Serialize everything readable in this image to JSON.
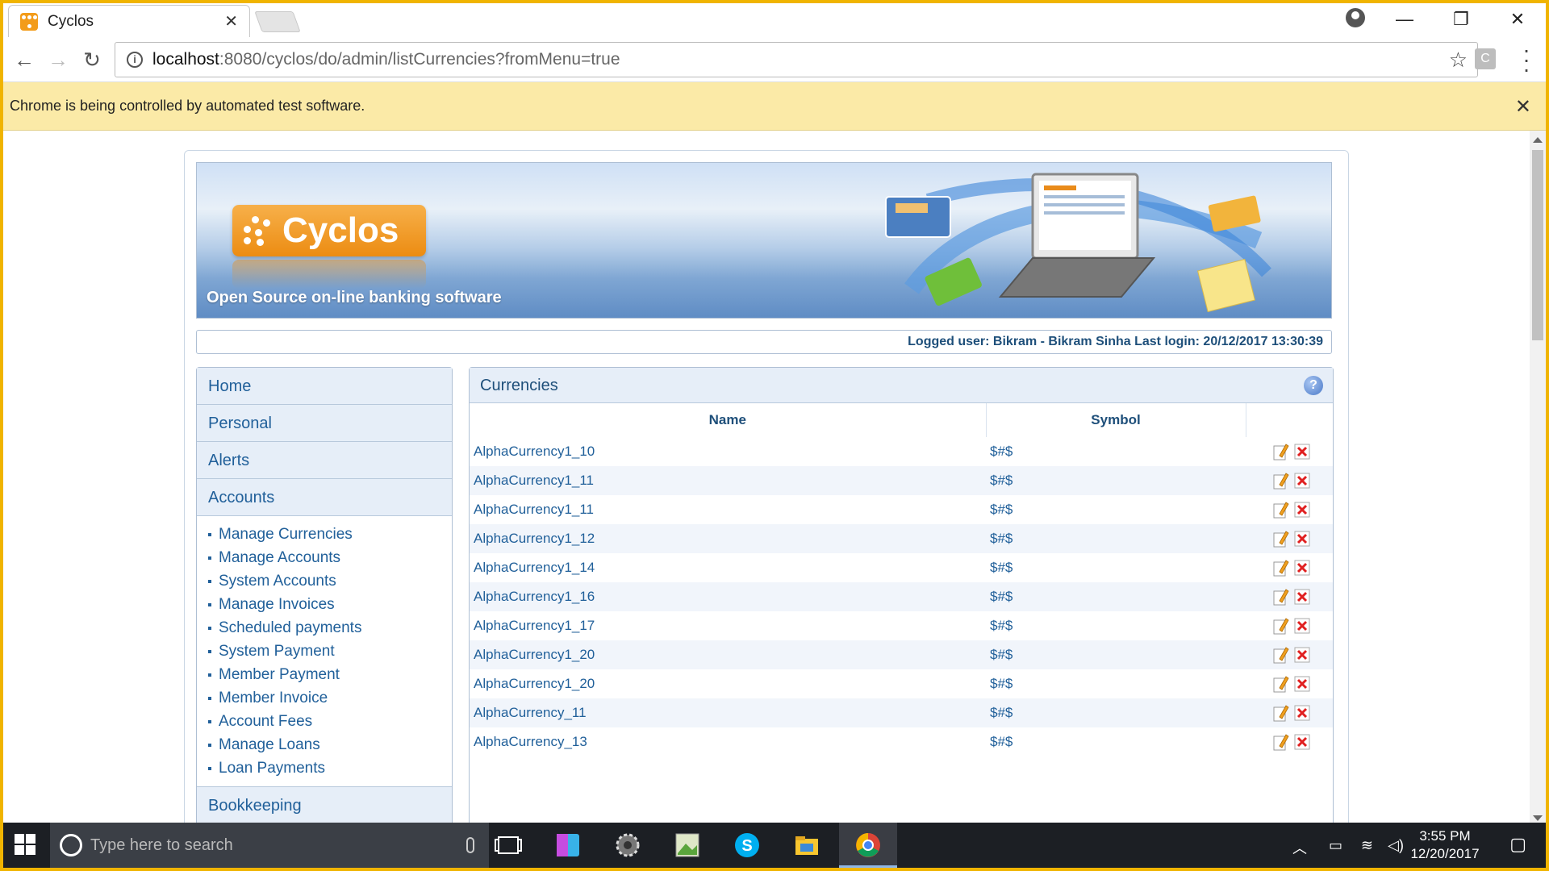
{
  "browser": {
    "tab_title": "Cyclos",
    "url_host": "localhost",
    "url_path": ":8080/cyclos/do/admin/listCurrencies?fromMenu=true",
    "infobar_message": "Chrome is being controlled by automated test software.",
    "extension_label": "C"
  },
  "banner": {
    "logo_text": "Cyclos",
    "tagline": "Open Source on-line banking software"
  },
  "userbar": {
    "text": "Logged user: Bikram - Bikram Sinha   Last login: 20/12/2017 13:30:39"
  },
  "menu": {
    "home": "Home",
    "personal": "Personal",
    "alerts": "Alerts",
    "accounts": "Accounts",
    "accounts_items": [
      "Manage Currencies",
      "Manage Accounts",
      "System Accounts",
      "Manage Invoices",
      "Scheduled payments",
      "System Payment",
      "Member Payment",
      "Member Invoice",
      "Account Fees",
      "Manage Loans",
      "Loan Payments"
    ],
    "bookkeeping": "Bookkeeping"
  },
  "content": {
    "title": "Currencies",
    "help_label": "?",
    "columns": [
      "Name",
      "Symbol",
      ""
    ],
    "rows": [
      {
        "name": "AlphaCurrency1_10",
        "symbol": "$#$"
      },
      {
        "name": "AlphaCurrency1_11",
        "symbol": "$#$"
      },
      {
        "name": "AlphaCurrency1_11",
        "symbol": "$#$"
      },
      {
        "name": "AlphaCurrency1_12",
        "symbol": "$#$"
      },
      {
        "name": "AlphaCurrency1_14",
        "symbol": "$#$"
      },
      {
        "name": "AlphaCurrency1_16",
        "symbol": "$#$"
      },
      {
        "name": "AlphaCurrency1_17",
        "symbol": "$#$"
      },
      {
        "name": "AlphaCurrency1_20",
        "symbol": "$#$"
      },
      {
        "name": "AlphaCurrency1_20",
        "symbol": "$#$"
      },
      {
        "name": "AlphaCurrency_11",
        "symbol": "$#$"
      },
      {
        "name": "AlphaCurrency_13",
        "symbol": "$#$"
      }
    ]
  },
  "taskbar": {
    "search_placeholder": "Type here to search",
    "time": "3:55 PM",
    "date": "12/20/2017"
  },
  "colors": {
    "window_border": "#f0b400",
    "link_blue": "#21609a",
    "header_blue": "#1e4f7a",
    "infobar_bg": "#fbeaa7"
  }
}
